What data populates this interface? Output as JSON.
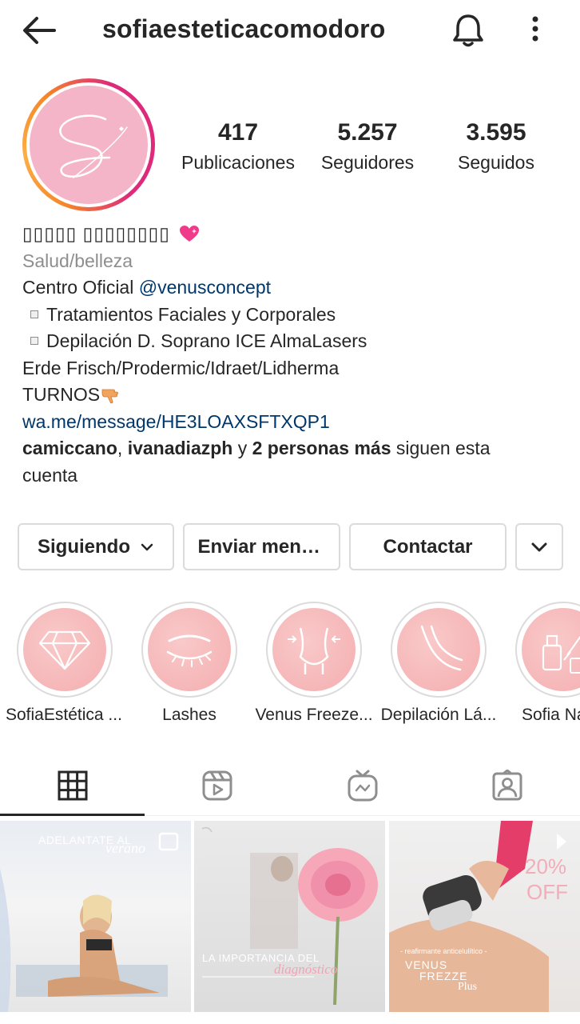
{
  "header": {
    "username": "sofiaesteticacomodoro",
    "icons": [
      "back-arrow-icon",
      "bell-icon",
      "more-vertical-icon"
    ]
  },
  "stats": [
    {
      "value": "417",
      "label": "Publicaciones"
    },
    {
      "value": "5.257",
      "label": "Seguidores"
    },
    {
      "value": "3.595",
      "label": "Seguidos"
    }
  ],
  "bio": {
    "name": "▯▯▯▯▯ ▯▯▯▯▯▯▯▯",
    "category": "Salud/belleza",
    "line1_prefix": "Centro Oficial ",
    "line1_mention": "@venusconcept",
    "line2": "Tratamientos Faciales y Corporales",
    "line3": "Depilación D. Soprano ICE AlmaLasers",
    "line4": "Erde Frisch/Prodermic/Idraet/Lidherma",
    "line5": "TURNOS",
    "link": "wa.me/message/HE3LOAXSFTXQP1",
    "followed_by_user1": "camiccano",
    "followed_by_sep": ", ",
    "followed_by_user2": "ivanadiazph",
    "followed_by_and": " y ",
    "followed_by_more": "2 personas más",
    "followed_by_suffix": " siguen esta cuenta"
  },
  "buttons": {
    "following": "Siguiendo",
    "message": "Enviar mensaje",
    "contact": "Contactar"
  },
  "highlights": [
    {
      "label": "SofiaEstética ...",
      "icon": "diamond-icon"
    },
    {
      "label": "Lashes",
      "icon": "eye-lashes-icon"
    },
    {
      "label": "Venus Freeze...",
      "icon": "body-waist-icon"
    },
    {
      "label": "Depilación Lá...",
      "icon": "legs-icon"
    },
    {
      "label": "Sofia Na",
      "icon": "nail-polish-icon"
    }
  ],
  "tabs": [
    {
      "name": "grid",
      "icon": "grid-icon",
      "active": true
    },
    {
      "name": "reels",
      "icon": "reels-icon",
      "active": false
    },
    {
      "name": "igtv",
      "icon": "igtv-icon",
      "active": false
    },
    {
      "name": "tagged",
      "icon": "tagged-person-icon",
      "active": false
    }
  ],
  "posts": [
    {
      "caption_top": "ADELANTATE AL",
      "caption_script": "verano"
    },
    {
      "caption_top": "LA IMPORTANCIA DEL",
      "caption_script": "diagnóstico"
    },
    {
      "caption_small": "- reafirmante anticelulítico -",
      "caption_title1": "VENUS",
      "caption_title2": "FREZZE",
      "caption_title3": "Plus",
      "badge_line1": "20%",
      "badge_line2": "OFF"
    }
  ],
  "colors": {
    "text": "#262626",
    "secondary": "#8e8e8e",
    "link": "#00376b",
    "border": "#dbdbdb",
    "pink": "#f5b5c8"
  }
}
